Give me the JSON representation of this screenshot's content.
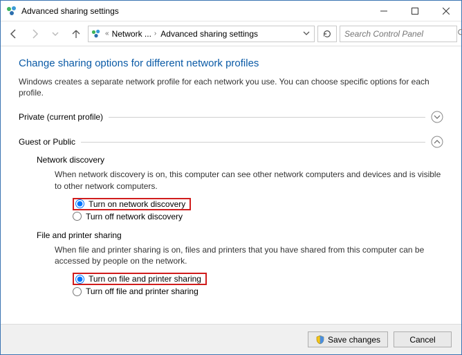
{
  "titlebar": {
    "title": "Advanced sharing settings"
  },
  "breadcrumb": {
    "item1": "Network ...",
    "item2": "Advanced sharing settings"
  },
  "search": {
    "placeholder": "Search Control Panel"
  },
  "heading": "Change sharing options for different network profiles",
  "intro": "Windows creates a separate network profile for each network you use. You can choose specific options for each profile.",
  "sections": {
    "private": {
      "label": "Private (current profile)"
    },
    "guest": {
      "label": "Guest or Public",
      "network_discovery": {
        "title": "Network discovery",
        "desc": "When network discovery is on, this computer can see other network computers and devices and is visible to other network computers.",
        "on": "Turn on network discovery",
        "off": "Turn off network discovery"
      },
      "file_printer": {
        "title": "File and printer sharing",
        "desc": "When file and printer sharing is on, files and printers that you have shared from this computer can be accessed by people on the network.",
        "on": "Turn on file and printer sharing",
        "off": "Turn off file and printer sharing"
      }
    }
  },
  "footer": {
    "save": "Save changes",
    "cancel": "Cancel"
  }
}
